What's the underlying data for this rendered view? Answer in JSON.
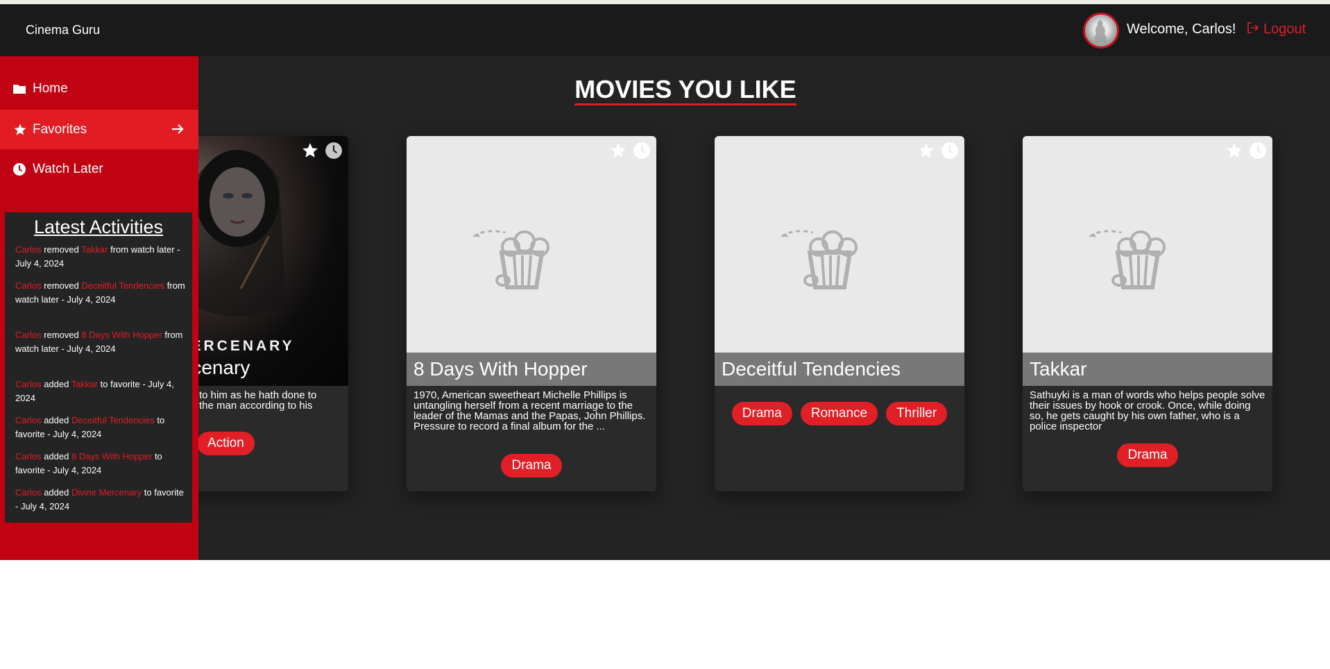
{
  "header": {
    "brand": "Cinema Guru",
    "welcome": "Welcome, Carlos!",
    "logout_label": "Logout"
  },
  "sidebar": {
    "items": [
      {
        "label": "Home",
        "icon": "folder-icon"
      },
      {
        "label": "Favorites",
        "icon": "star-icon",
        "active": true
      },
      {
        "label": "Watch Later",
        "icon": "clock-icon"
      }
    ]
  },
  "activities": {
    "title": "Latest Activities",
    "items": [
      {
        "user": "Carlos",
        "action": "removed",
        "movie": "Takkar",
        "suffix": "from watch later - July 4, 2024"
      },
      {
        "user": "Carlos",
        "action": "removed",
        "movie": "Deceitful Tendencies",
        "suffix": "from watch later - July 4, 2024"
      },
      {
        "user": "Carlos",
        "action": "removed",
        "movie": "8 Days With Hopper",
        "suffix": "from watch later - July 4, 2024"
      },
      {
        "user": "Carlos",
        "action": "added",
        "movie": "Takkar",
        "suffix": "to favorite - July 4, 2024"
      },
      {
        "user": "Carlos",
        "action": "added",
        "movie": "Deceitful Tendencies",
        "suffix": "to favorite - July 4, 2024"
      },
      {
        "user": "Carlos",
        "action": "added",
        "movie": "8 Days With Hopper",
        "suffix": "to favorite - July 4, 2024"
      },
      {
        "user": "Carlos",
        "action": "added",
        "movie": "Divine Mercenary",
        "suffix": "to favorite - July 4, 2024"
      }
    ]
  },
  "main": {
    "title": "MOVIES YOU LIKE",
    "movies": [
      {
        "title": "rcenary",
        "poster_text": "MERCENARY",
        "synopsis_line1": "to him as he hath done to",
        "synopsis_line2": "the man according to his",
        "genres": [
          "Action"
        ]
      },
      {
        "title": "8 Days With Hopper",
        "synopsis": "1970, American sweetheart Michelle Phillips is untangling herself from a recent marriage to the leader of the Mamas and the Papas, John Phillips. Pressure to record a final album for the ...",
        "genres": [
          "Drama"
        ]
      },
      {
        "title": "Deceitful Tendencies",
        "synopsis": "",
        "genres": [
          "Drama",
          "Romance",
          "Thriller"
        ]
      },
      {
        "title": "Takkar",
        "synopsis": "Sathuyki is a man of words who helps people solve their issues by hook or crook. Once, while doing so, he gets caught by his own father, who is a police inspector",
        "genres": [
          "Drama"
        ]
      }
    ]
  },
  "colors": {
    "accent": "#e31c24",
    "sidebar": "#c00212",
    "header": "#1a1a1a",
    "main_bg": "#232323"
  }
}
